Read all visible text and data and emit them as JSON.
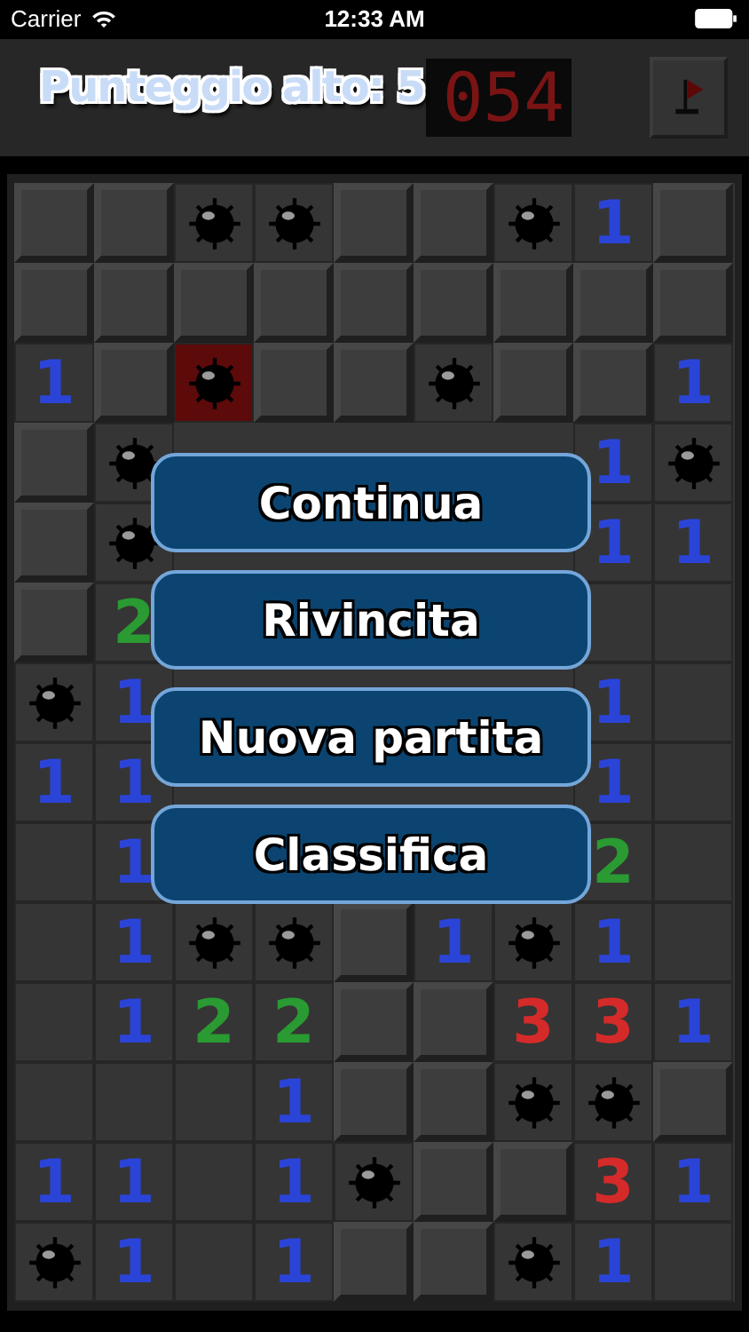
{
  "status_bar": {
    "carrier": "Carrier",
    "time": "12:33 AM"
  },
  "header": {
    "title": "Punteggio alto: 5",
    "counter": "054"
  },
  "board": [
    [
      {
        "kind": "hidden"
      },
      {
        "kind": "hidden"
      },
      {
        "kind": "mine"
      },
      {
        "kind": "mine"
      },
      {
        "kind": "hidden"
      },
      {
        "kind": "hidden"
      },
      {
        "kind": "mine"
      },
      {
        "kind": "number",
        "text": "1",
        "color": "#2b44d8"
      },
      {
        "kind": "hidden"
      }
    ],
    [
      {
        "kind": "hidden"
      },
      {
        "kind": "hidden"
      },
      {
        "kind": "hidden"
      },
      {
        "kind": "hidden"
      },
      {
        "kind": "hidden"
      },
      {
        "kind": "hidden"
      },
      {
        "kind": "hidden"
      },
      {
        "kind": "hidden"
      },
      {
        "kind": "hidden"
      }
    ],
    [
      {
        "kind": "number",
        "text": "1",
        "color": "#2b44d8"
      },
      {
        "kind": "hidden"
      },
      {
        "kind": "exploded"
      },
      {
        "kind": "hidden"
      },
      {
        "kind": "hidden"
      },
      {
        "kind": "mine"
      },
      {
        "kind": "hidden"
      },
      {
        "kind": "hidden"
      },
      {
        "kind": "number",
        "text": "1",
        "color": "#2b44d8"
      }
    ],
    [
      {
        "kind": "hidden"
      },
      {
        "kind": "mine"
      },
      {
        "kind": "covered"
      },
      {
        "kind": "covered"
      },
      {
        "kind": "covered"
      },
      {
        "kind": "covered"
      },
      {
        "kind": "covered"
      },
      {
        "kind": "number",
        "text": "1",
        "color": "#2b44d8"
      },
      {
        "kind": "mine"
      }
    ],
    [
      {
        "kind": "hidden"
      },
      {
        "kind": "mine"
      },
      {
        "kind": "covered"
      },
      {
        "kind": "covered"
      },
      {
        "kind": "covered"
      },
      {
        "kind": "covered"
      },
      {
        "kind": "covered"
      },
      {
        "kind": "number",
        "text": "1",
        "color": "#2b44d8"
      },
      {
        "kind": "number",
        "text": "1",
        "color": "#2b44d8"
      }
    ],
    [
      {
        "kind": "hidden"
      },
      {
        "kind": "number",
        "text": "2",
        "color": "#2a9a32"
      },
      {
        "kind": "covered"
      },
      {
        "kind": "covered"
      },
      {
        "kind": "covered"
      },
      {
        "kind": "covered"
      },
      {
        "kind": "covered"
      },
      {
        "kind": "open"
      },
      {
        "kind": "open"
      }
    ],
    [
      {
        "kind": "mine"
      },
      {
        "kind": "number",
        "text": "1",
        "color": "#2b44d8"
      },
      {
        "kind": "covered"
      },
      {
        "kind": "covered"
      },
      {
        "kind": "covered"
      },
      {
        "kind": "covered"
      },
      {
        "kind": "covered"
      },
      {
        "kind": "number",
        "text": "1",
        "color": "#2b44d8"
      },
      {
        "kind": "open"
      }
    ],
    [
      {
        "kind": "number",
        "text": "1",
        "color": "#2b44d8"
      },
      {
        "kind": "number",
        "text": "1",
        "color": "#2b44d8"
      },
      {
        "kind": "covered"
      },
      {
        "kind": "covered"
      },
      {
        "kind": "covered"
      },
      {
        "kind": "covered"
      },
      {
        "kind": "covered"
      },
      {
        "kind": "number",
        "text": "1",
        "color": "#2b44d8"
      },
      {
        "kind": "open"
      }
    ],
    [
      {
        "kind": "open"
      },
      {
        "kind": "number",
        "text": "1",
        "color": "#2b44d8"
      },
      {
        "kind": "covered"
      },
      {
        "kind": "covered"
      },
      {
        "kind": "covered"
      },
      {
        "kind": "covered"
      },
      {
        "kind": "covered"
      },
      {
        "kind": "number",
        "text": "2",
        "color": "#2a9a32"
      },
      {
        "kind": "open"
      }
    ],
    [
      {
        "kind": "open"
      },
      {
        "kind": "number",
        "text": "1",
        "color": "#2b44d8"
      },
      {
        "kind": "mine"
      },
      {
        "kind": "mine"
      },
      {
        "kind": "hidden"
      },
      {
        "kind": "number",
        "text": "1",
        "color": "#2b44d8"
      },
      {
        "kind": "mine"
      },
      {
        "kind": "number",
        "text": "1",
        "color": "#2b44d8"
      },
      {
        "kind": "open"
      }
    ],
    [
      {
        "kind": "open"
      },
      {
        "kind": "number",
        "text": "1",
        "color": "#2b44d8"
      },
      {
        "kind": "number",
        "text": "2",
        "color": "#2a9a32"
      },
      {
        "kind": "number",
        "text": "2",
        "color": "#2a9a32"
      },
      {
        "kind": "hidden"
      },
      {
        "kind": "hidden"
      },
      {
        "kind": "number",
        "text": "3",
        "color": "#d42a2a"
      },
      {
        "kind": "number",
        "text": "3",
        "color": "#d42a2a"
      },
      {
        "kind": "number",
        "text": "1",
        "color": "#2b44d8"
      }
    ],
    [
      {
        "kind": "open"
      },
      {
        "kind": "open"
      },
      {
        "kind": "open"
      },
      {
        "kind": "number",
        "text": "1",
        "color": "#2b44d8"
      },
      {
        "kind": "hidden"
      },
      {
        "kind": "hidden"
      },
      {
        "kind": "mine"
      },
      {
        "kind": "mine"
      },
      {
        "kind": "hidden"
      }
    ],
    [
      {
        "kind": "number",
        "text": "1",
        "color": "#2b44d8"
      },
      {
        "kind": "number",
        "text": "1",
        "color": "#2b44d8"
      },
      {
        "kind": "open"
      },
      {
        "kind": "number",
        "text": "1",
        "color": "#2b44d8"
      },
      {
        "kind": "mine"
      },
      {
        "kind": "hidden"
      },
      {
        "kind": "hidden"
      },
      {
        "kind": "number",
        "text": "3",
        "color": "#d42a2a"
      },
      {
        "kind": "number",
        "text": "1",
        "color": "#2b44d8"
      }
    ],
    [
      {
        "kind": "mine"
      },
      {
        "kind": "number",
        "text": "1",
        "color": "#2b44d8"
      },
      {
        "kind": "open"
      },
      {
        "kind": "number",
        "text": "1",
        "color": "#2b44d8"
      },
      {
        "kind": "hidden"
      },
      {
        "kind": "hidden"
      },
      {
        "kind": "mine"
      },
      {
        "kind": "number",
        "text": "1",
        "color": "#2b44d8"
      },
      {
        "kind": "open"
      }
    ]
  ],
  "menu": [
    "Continua",
    "Rivincita",
    "Nuova partita",
    "Classifica"
  ]
}
